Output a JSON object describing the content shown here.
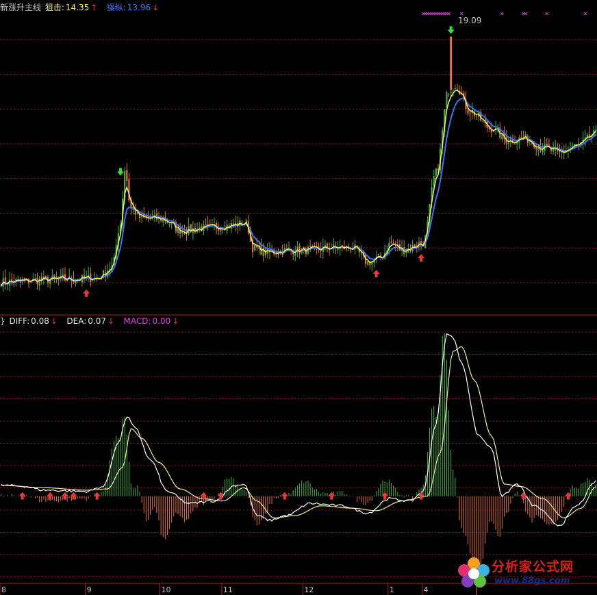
{
  "top_panel": {
    "indicator_name": "新涨升主线",
    "line1_label": "狙击:",
    "line1_value": "14.35",
    "line1_arrow": "↑",
    "line1_color": "#f7f06a",
    "line2_label": "操纵:",
    "line2_value": "13.96",
    "line2_arrow": "↓",
    "line2_color": "#3a78f0",
    "peak_price_label": "19.09"
  },
  "bottom_panel": {
    "diff_label": "DIFF:",
    "diff_value": "0.08",
    "diff_arrow": "↓",
    "dea_label": "DEA:",
    "dea_value": "0.07",
    "dea_arrow": "↓",
    "macd_label": "MACD:",
    "macd_value": "0.00",
    "macd_arrow": "↓",
    "macd_color": "#e040e0"
  },
  "watermark": {
    "name": "分析家公式网",
    "url": "www.88gs.com"
  },
  "colors": {
    "up_candle": "#3cb43c",
    "down_candle": "#e8703c",
    "grid": "#8b1a1a",
    "buy_arrow": "#e83a3a",
    "sell_arrow": "#30e030",
    "cross_marker": "#c040c0"
  },
  "chart_data": {
    "type": "line",
    "x_axis_labels": [
      "8",
      "9",
      "10",
      "11",
      "12",
      "1",
      "4"
    ],
    "x_axis_label_index": [
      0,
      40,
      75,
      104,
      142,
      182,
      198
    ],
    "bars": 280,
    "price": {
      "ylim": [
        8.2,
        20.2
      ],
      "keyframes": [
        [
          0,
          9.0
        ],
        [
          30,
          9.1
        ],
        [
          45,
          9.15
        ],
        [
          52,
          9.6
        ],
        [
          56,
          11.4
        ],
        [
          58,
          13.6
        ],
        [
          61,
          12.0
        ],
        [
          66,
          11.6
        ],
        [
          75,
          11.6
        ],
        [
          85,
          11.1
        ],
        [
          95,
          11.2
        ],
        [
          105,
          11.3
        ],
        [
          115,
          11.4
        ],
        [
          118,
          10.4
        ],
        [
          125,
          10.2
        ],
        [
          135,
          10.3
        ],
        [
          145,
          10.3
        ],
        [
          155,
          10.4
        ],
        [
          165,
          10.4
        ],
        [
          172,
          9.8
        ],
        [
          178,
          10.0
        ],
        [
          183,
          10.6
        ],
        [
          188,
          10.3
        ],
        [
          198,
          10.6
        ],
        [
          204,
          13.5
        ],
        [
          210,
          16.9
        ],
        [
          213,
          17.1
        ],
        [
          220,
          16.0
        ],
        [
          230,
          15.3
        ],
        [
          238,
          14.8
        ],
        [
          245,
          14.9
        ],
        [
          255,
          14.5
        ],
        [
          262,
          14.3
        ],
        [
          270,
          14.6
        ],
        [
          279,
          15.1
        ]
      ],
      "line1_name": "狙击",
      "line2_name": "操纵",
      "peak_price": 19.09,
      "peak_index": 211,
      "buy_signals": [
        40,
        176,
        197
      ],
      "sell_signals": [
        56,
        211
      ],
      "cross_markers": [
        198,
        199,
        200,
        201,
        202,
        203,
        204,
        205,
        206,
        207,
        208,
        209,
        210,
        216,
        235,
        245,
        246,
        256,
        274
      ]
    },
    "macd": {
      "ylim": [
        -0.35,
        0.7
      ],
      "diff_keyframes": [
        [
          0,
          0.045
        ],
        [
          10,
          0.042
        ],
        [
          20,
          0.025
        ],
        [
          40,
          0.02
        ],
        [
          48,
          0.04
        ],
        [
          55,
          0.22
        ],
        [
          59,
          0.33
        ],
        [
          63,
          0.28
        ],
        [
          70,
          0.15
        ],
        [
          78,
          0.02
        ],
        [
          88,
          -0.03
        ],
        [
          100,
          -0.02
        ],
        [
          110,
          0.045
        ],
        [
          114,
          0.05
        ],
        [
          120,
          -0.08
        ],
        [
          126,
          -0.1
        ],
        [
          134,
          -0.08
        ],
        [
          145,
          -0.03
        ],
        [
          160,
          -0.04
        ],
        [
          172,
          -0.07
        ],
        [
          182,
          -0.01
        ],
        [
          192,
          -0.02
        ],
        [
          198,
          0.02
        ],
        [
          204,
          0.3
        ],
        [
          209,
          0.67
        ],
        [
          212,
          0.66
        ],
        [
          216,
          0.55
        ],
        [
          224,
          0.25
        ],
        [
          230,
          0.2
        ],
        [
          235,
          0.0
        ],
        [
          242,
          0.05
        ],
        [
          250,
          -0.04
        ],
        [
          262,
          -0.12
        ],
        [
          270,
          -0.04
        ],
        [
          279,
          0.06
        ]
      ],
      "dea_keyframes": [
        [
          0,
          0.045
        ],
        [
          20,
          0.035
        ],
        [
          40,
          0.025
        ],
        [
          50,
          0.03
        ],
        [
          57,
          0.12
        ],
        [
          61,
          0.28
        ],
        [
          66,
          0.24
        ],
        [
          74,
          0.14
        ],
        [
          84,
          0.03
        ],
        [
          94,
          -0.01
        ],
        [
          104,
          -0.02
        ],
        [
          114,
          0.035
        ],
        [
          120,
          -0.02
        ],
        [
          128,
          -0.09
        ],
        [
          138,
          -0.08
        ],
        [
          150,
          -0.04
        ],
        [
          165,
          -0.05
        ],
        [
          176,
          -0.06
        ],
        [
          188,
          -0.02
        ],
        [
          200,
          0.0
        ],
        [
          206,
          0.18
        ],
        [
          212,
          0.6
        ],
        [
          216,
          0.62
        ],
        [
          222,
          0.48
        ],
        [
          230,
          0.25
        ],
        [
          236,
          0.05
        ],
        [
          244,
          0.04
        ],
        [
          254,
          -0.01
        ],
        [
          264,
          -0.09
        ],
        [
          272,
          -0.05
        ],
        [
          279,
          0.04
        ]
      ],
      "buy_signals": [
        10,
        23,
        30,
        34,
        45,
        95,
        103,
        133,
        155,
        180,
        197,
        245,
        266
      ],
      "zero_line": 0
    }
  }
}
